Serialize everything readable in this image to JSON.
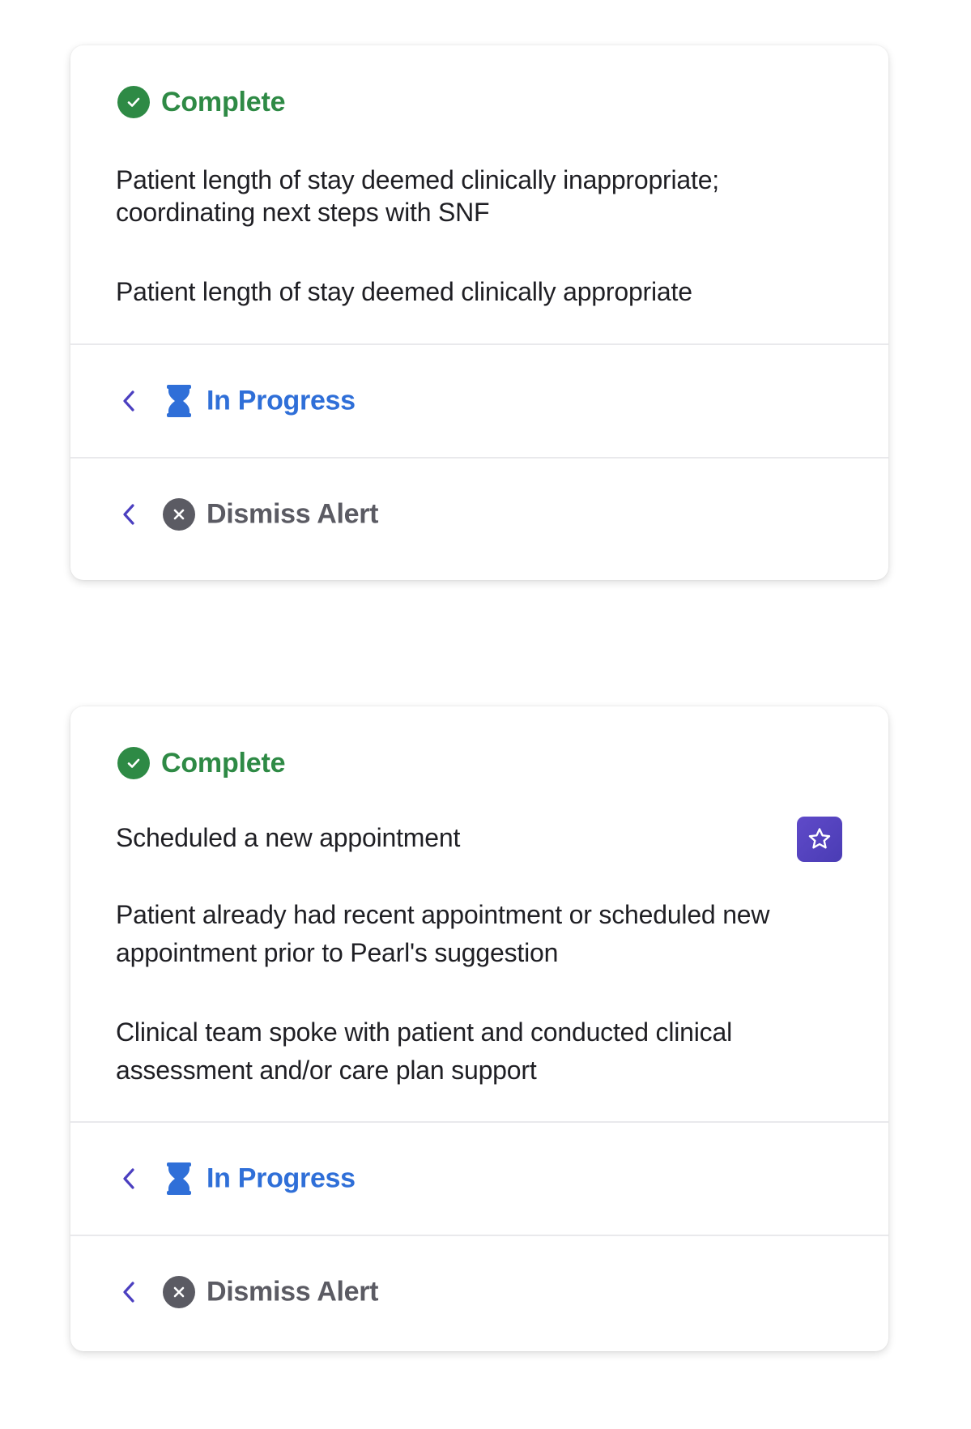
{
  "cards": [
    {
      "status_label": "Complete",
      "options": [
        "Patient length of stay deemed clinically inappropriate; coordinating next steps with SNF",
        "Patient length of stay deemed clinically appropriate"
      ],
      "in_progress_label": "In Progress",
      "dismiss_label": "Dismiss Alert"
    },
    {
      "status_label": "Complete",
      "options": [
        "Scheduled a new appointment",
        "Patient already had recent appointment or scheduled new appointment prior to Pearl's suggestion",
        "Clinical team spoke with patient and conducted clinical assessment and/or care plan support"
      ],
      "in_progress_label": "In Progress",
      "dismiss_label": "Dismiss Alert"
    }
  ],
  "icons": {
    "complete": "check-circle-icon",
    "in_progress": "hourglass-icon",
    "dismiss": "close-circle-icon",
    "back": "chevron-left-icon",
    "favorite": "star-icon"
  },
  "colors": {
    "complete": "#2e8a45",
    "in_progress": "#2f6fd8",
    "dismiss": "#5b5b63",
    "accent": "#4f3fbd"
  }
}
